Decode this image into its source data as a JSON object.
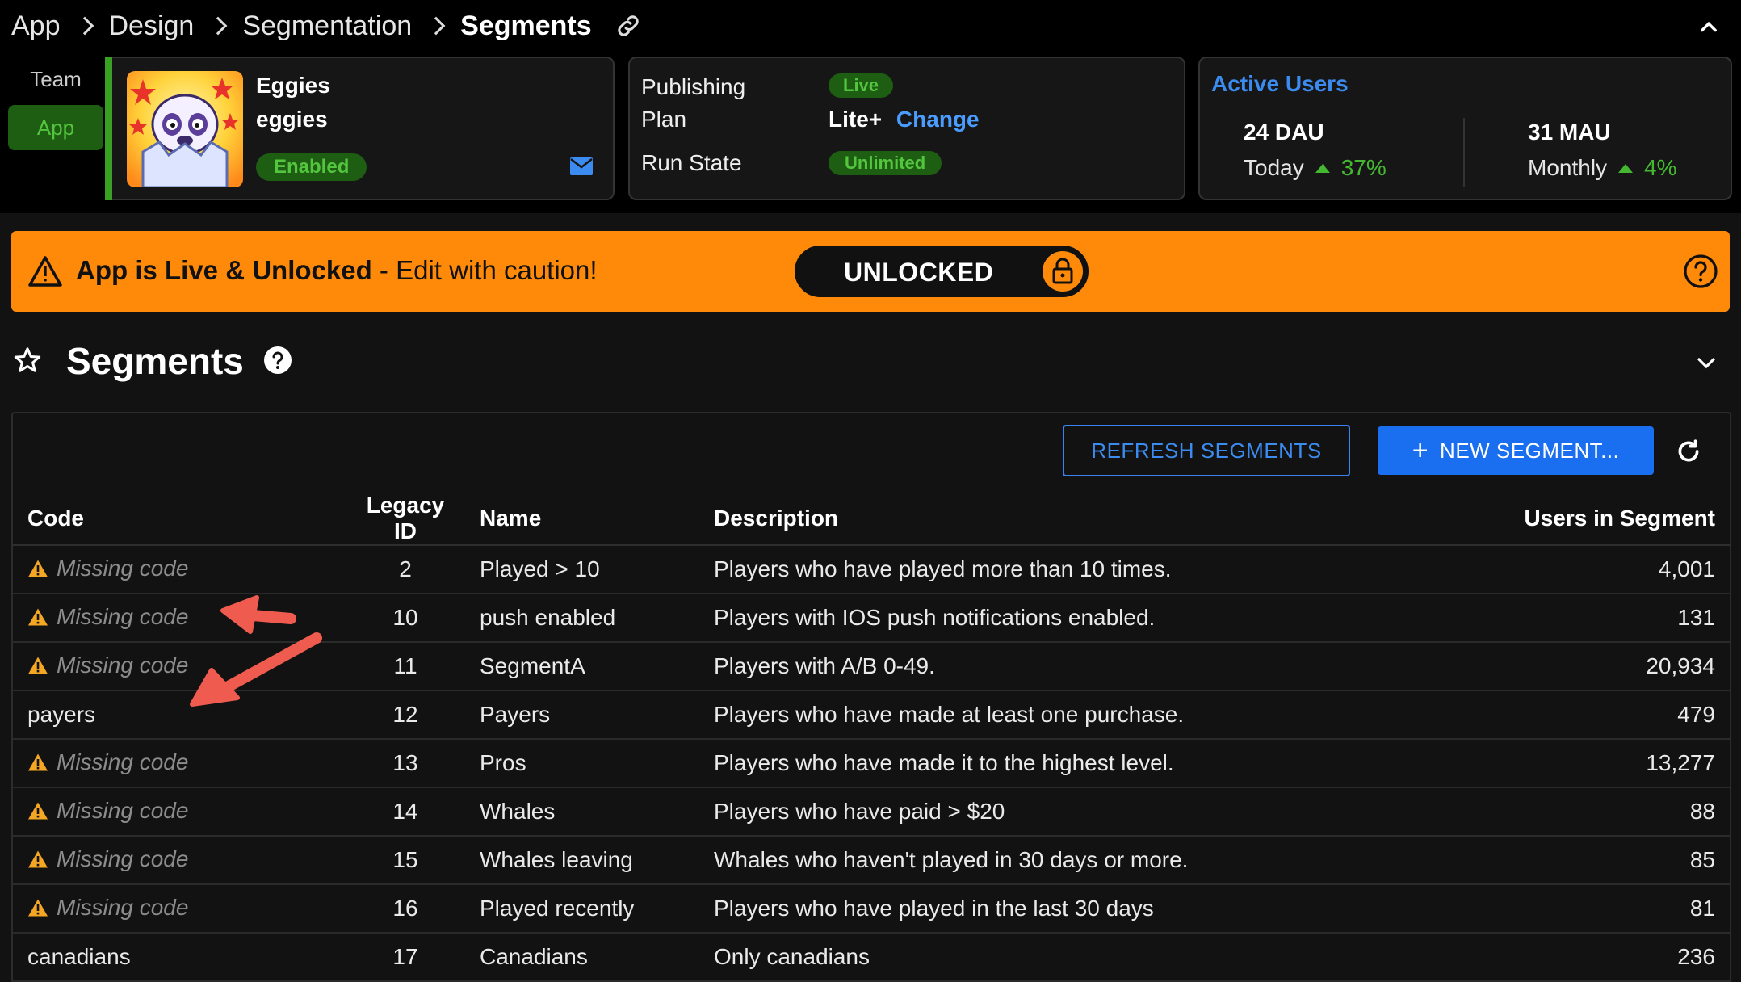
{
  "breadcrumb": {
    "items": [
      "App",
      "Design",
      "Segmentation"
    ],
    "current": "Segments"
  },
  "sidebar": {
    "team_label": "Team",
    "app_label": "App"
  },
  "app_card": {
    "name": "Eggies",
    "short_code": "eggies",
    "status": "Enabled"
  },
  "publishing_card": {
    "publishing_label": "Publishing",
    "publishing_value": "Live",
    "plan_label": "Plan",
    "plan_value": "Lite+",
    "plan_change": "Change",
    "run_state_label": "Run State",
    "run_state_value": "Unlimited"
  },
  "active_users": {
    "title": "Active Users",
    "dau": "24 DAU",
    "dau_period": "Today",
    "dau_change": "37%",
    "mau": "31 MAU",
    "mau_period": "Monthly",
    "mau_change": "4%"
  },
  "banner": {
    "bold_text": "App is Live & Unlocked",
    "text": " - Edit with caution!",
    "lock_label": "UNLOCKED"
  },
  "section": {
    "title": "Segments"
  },
  "toolbar": {
    "refresh_label": "REFRESH SEGMENTS",
    "new_label": "NEW SEGMENT..."
  },
  "table": {
    "headers": [
      "Code",
      "Legacy ID",
      "Name",
      "Description",
      "Users in Segment"
    ],
    "missing_label": "Missing code",
    "rows": [
      {
        "code": "",
        "legacy_id": "2",
        "name": "Played > 10",
        "description": "Players who have played more than 10 times.",
        "users": "4,001"
      },
      {
        "code": "",
        "legacy_id": "10",
        "name": "push enabled",
        "description": "Players with IOS push notifications enabled.",
        "users": "131"
      },
      {
        "code": "",
        "legacy_id": "11",
        "name": "SegmentA",
        "description": "Players with A/B 0-49.",
        "users": "20,934"
      },
      {
        "code": "payers",
        "legacy_id": "12",
        "name": "Payers",
        "description": "Players who have made at least one purchase.",
        "users": "479"
      },
      {
        "code": "",
        "legacy_id": "13",
        "name": "Pros",
        "description": "Players who have made it to the highest level.",
        "users": "13,277"
      },
      {
        "code": "",
        "legacy_id": "14",
        "name": "Whales",
        "description": "Players who have paid > $20",
        "users": "88"
      },
      {
        "code": "",
        "legacy_id": "15",
        "name": "Whales leaving",
        "description": "Whales who haven't played in 30 days or more.",
        "users": "85"
      },
      {
        "code": "",
        "legacy_id": "16",
        "name": "Played recently",
        "description": "Players who have played in the last 30 days",
        "users": "81"
      },
      {
        "code": "canadians",
        "legacy_id": "17",
        "name": "Canadians",
        "description": "Only canadians",
        "users": "236"
      }
    ]
  },
  "colors": {
    "banner": "#ff8a0a",
    "accent_blue": "#1a6ef0",
    "live_green": "#54c53f",
    "warning_yellow": "#f5a623",
    "annotation_arrow": "#ef5b4f"
  },
  "icons": [
    "link-icon",
    "chevron-up-icon",
    "mail-icon",
    "warning-icon",
    "lock-icon",
    "help-icon",
    "star-icon",
    "chevron-down-icon",
    "plus-icon",
    "refresh-icon"
  ]
}
